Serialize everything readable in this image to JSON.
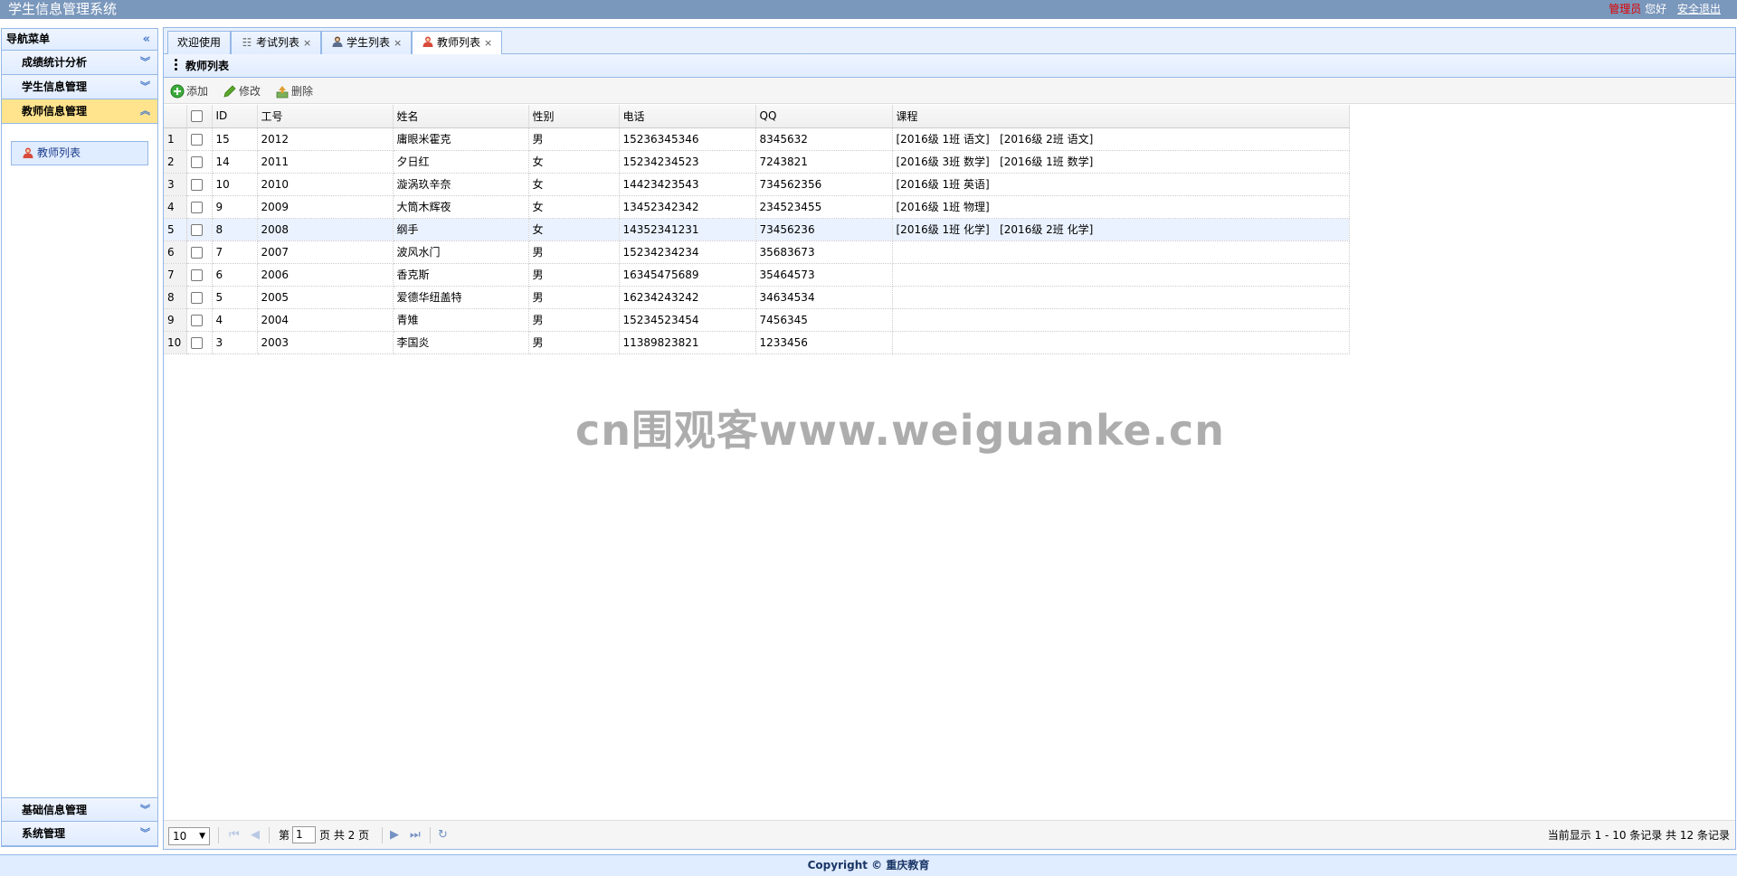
{
  "header": {
    "title": "学生信息管理系统",
    "role": "管理员",
    "greeting": "您好",
    "logout": "安全退出"
  },
  "nav": {
    "title": "导航菜单",
    "sections": [
      {
        "label": "成绩统计分析"
      },
      {
        "label": "学生信息管理"
      },
      {
        "label": "教师信息管理"
      }
    ],
    "active_item": "教师列表",
    "bottom_sections": [
      {
        "label": "基础信息管理"
      },
      {
        "label": "系统管理"
      }
    ]
  },
  "tabs": [
    {
      "label": "欢迎使用"
    },
    {
      "label": "考试列表",
      "icon": "list-icon"
    },
    {
      "label": "学生列表",
      "icon": "user-icon"
    },
    {
      "label": "教师列表",
      "icon": "user-red-icon"
    }
  ],
  "panel": {
    "title": "教师列表",
    "toolbar": {
      "add": "添加",
      "edit": "修改",
      "delete": "删除"
    }
  },
  "grid": {
    "columns": [
      "ID",
      "工号",
      "姓名",
      "性别",
      "电话",
      "QQ",
      "课程"
    ],
    "rows": [
      {
        "n": "1",
        "id": "15",
        "no": "2012",
        "name": "庸眼米霍克",
        "sex": "男",
        "phone": "15236345346",
        "qq": "8345632",
        "course": "[2016级 1班 语文]   [2016级 2班 语文]"
      },
      {
        "n": "2",
        "id": "14",
        "no": "2011",
        "name": "夕日红",
        "sex": "女",
        "phone": "15234234523",
        "qq": "7243821",
        "course": "[2016级 3班 数学]   [2016级 1班 数学]"
      },
      {
        "n": "3",
        "id": "10",
        "no": "2010",
        "name": "漩涡玖辛奈",
        "sex": "女",
        "phone": "14423423543",
        "qq": "734562356",
        "course": "[2016级 1班 英语]"
      },
      {
        "n": "4",
        "id": "9",
        "no": "2009",
        "name": "大筒木辉夜",
        "sex": "女",
        "phone": "13452342342",
        "qq": "234523455",
        "course": "[2016级 1班 物理]"
      },
      {
        "n": "5",
        "id": "8",
        "no": "2008",
        "name": "纲手",
        "sex": "女",
        "phone": "14352341231",
        "qq": "73456236",
        "course": "[2016级 1班 化学]   [2016级 2班 化学]"
      },
      {
        "n": "6",
        "id": "7",
        "no": "2007",
        "name": "波风水门",
        "sex": "男",
        "phone": "15234234234",
        "qq": "35683673",
        "course": ""
      },
      {
        "n": "7",
        "id": "6",
        "no": "2006",
        "name": "香克斯",
        "sex": "男",
        "phone": "16345475689",
        "qq": "35464573",
        "course": ""
      },
      {
        "n": "8",
        "id": "5",
        "no": "2005",
        "name": "爱德华纽盖特",
        "sex": "男",
        "phone": "16234243242",
        "qq": "34634534",
        "course": ""
      },
      {
        "n": "9",
        "id": "4",
        "no": "2004",
        "name": "青雉",
        "sex": "男",
        "phone": "15234523454",
        "qq": "7456345",
        "course": ""
      },
      {
        "n": "10",
        "id": "3",
        "no": "2003",
        "name": "李国炎",
        "sex": "男",
        "phone": "11389823821",
        "qq": "1233456",
        "course": ""
      }
    ],
    "selected_row": 5
  },
  "pager": {
    "page_size": "10",
    "page_prefix": "第",
    "page_value": "1",
    "page_suffix": "页 共 2 页",
    "summary": "当前显示 1 - 10 条记录 共 12 条记录"
  },
  "footer": "Copyright © 重庆教育",
  "watermark": "cn围观客www.weiguanke.cn"
}
